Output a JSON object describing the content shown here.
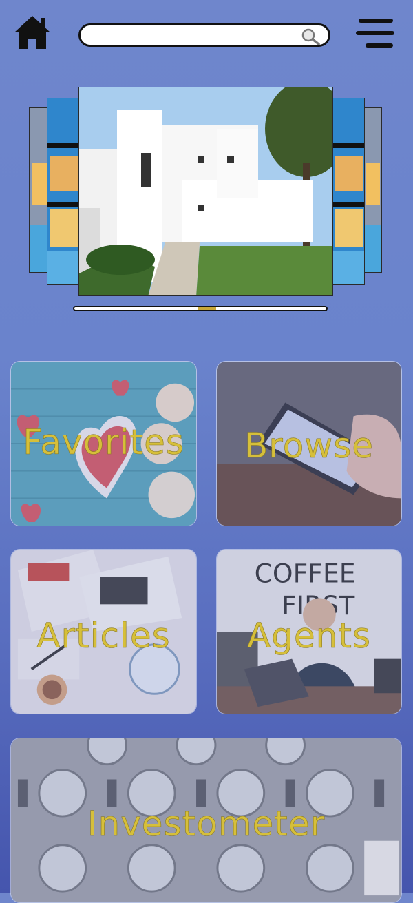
{
  "header": {
    "home_icon": "home-icon",
    "search": {
      "placeholder": "",
      "value": "",
      "icon": "magnifier-icon"
    },
    "menu_icon": "hamburger-menu-icon"
  },
  "carousel": {
    "slides": [
      "house-photo",
      "house-photo",
      "modern-white-house-photo",
      "house-photo",
      "house-photo"
    ],
    "active_index": 2,
    "indicator_color": "#c9a83a"
  },
  "tiles": {
    "favorites": "Favorites",
    "browse": "Browse",
    "articles": "Articles",
    "agents": "Agents",
    "investometer": "Investometer"
  },
  "colors": {
    "background_top": "#6f86cc",
    "background_bottom": "#4555ad",
    "tile_label": "#d6bf3a"
  }
}
